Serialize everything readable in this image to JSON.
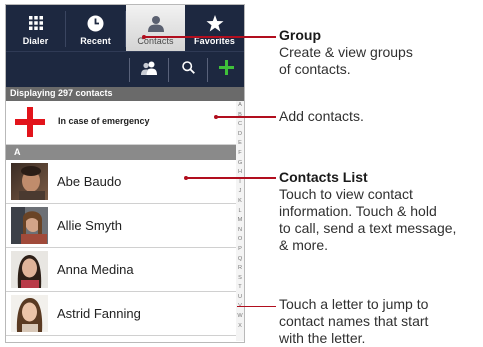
{
  "tabs": [
    {
      "label": "Dialer",
      "icon": "grid-icon"
    },
    {
      "label": "Recent",
      "icon": "clock-icon"
    },
    {
      "label": "Contacts",
      "icon": "person-icon",
      "active": true
    },
    {
      "label": "Favorites",
      "icon": "star-icon"
    }
  ],
  "toolbar": {
    "buttons": [
      "group-icon",
      "search-icon",
      "add-contact-icon"
    ]
  },
  "count_text": "Displaying 297 contacts",
  "emergency_label": "In case of emergency",
  "section_letter": "A",
  "contacts": [
    "Abe Baudo",
    "Allie Smyth",
    "Anna Medina",
    "Astrid Fanning"
  ],
  "alphabet": [
    "A",
    "B",
    "C",
    "D",
    "E",
    "F",
    "G",
    "H",
    "I",
    "J",
    "K",
    "L",
    "M",
    "N",
    "O",
    "P",
    "Q",
    "R",
    "S",
    "T",
    "U",
    "V",
    "W",
    "X"
  ],
  "annotations": {
    "group_title": "Group",
    "group_line1": "Create & view groups",
    "group_line2": "of contacts.",
    "add_line1": "Add contacts.",
    "list_title": "Contacts List",
    "list_line1": "Touch to view contact",
    "list_line2": "information. Touch & hold",
    "list_line3": "to call, send a text message,",
    "list_line4": "& more.",
    "letter_line1": "Touch a letter to jump to",
    "letter_line2": "contact names that start",
    "letter_line3": "with the letter."
  },
  "colors": {
    "tabbar": "#1d2840",
    "accent": "#e2141b",
    "callout": "#b10e1e",
    "add_green": "#3fc13a"
  }
}
